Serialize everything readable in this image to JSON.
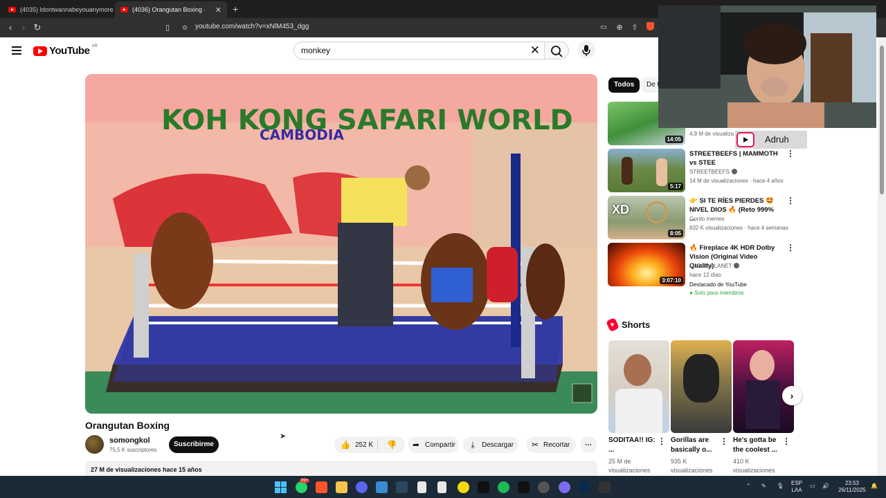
{
  "browser": {
    "tabs": [
      {
        "label": "(4035) Idontwannabeyouanymore Co",
        "active": false
      },
      {
        "label": "(4036) Orangutan Boxing - Yo",
        "active": true
      }
    ],
    "new_tab_icon": "plus-icon",
    "url": "youtube.com/watch?v=xNlM453_dgg"
  },
  "header": {
    "logo_text": "YouTube",
    "country": "AR",
    "search_value": "monkey"
  },
  "video": {
    "overlay_text": "KOH KONG SAFARI WORLD",
    "overlay_sub": "CAMBODIA",
    "title": "Orangutan Boxing",
    "channel": "somongkol",
    "subscribers": "75,5 K suscriptores",
    "subscribe_label": "Suscribirme",
    "likes": "252 K",
    "share_label": "Compartir",
    "download_label": "Descargar",
    "clip_label": "Recortar",
    "views_date": "27 M de visualizaciones  hace 15 años"
  },
  "chips": [
    "Todos",
    "De t"
  ],
  "recommendations": [
    {
      "title": "",
      "channel": "",
      "meta": "4,9 M de visualiza",
      "duration": "14:05"
    },
    {
      "title": "STREETBEEFS | MAMMOTH vs STEE",
      "channel": "STREETBEEFS",
      "meta": "14 M de visualizaciones · hace 4 años",
      "duration": "5:17"
    },
    {
      "title": "👉 SI TE RÍES PIERDES 🤩 NIVEL DIOS 🔥 (Reto 999% ...",
      "channel": "Gordo memes",
      "meta": "832 K visualizaciones · hace 4 semanas",
      "duration": "8:05"
    },
    {
      "title": "🔥 Fireplace 4K HDR Dolby Vision (Original Video Quality)",
      "channel": "FOBOS PLANET",
      "meta": "hace 12 días",
      "duration": "3:07:10",
      "featured": "Destacado de YouTube",
      "members": "Solo para miembros"
    }
  ],
  "shorts": {
    "header": "Shorts",
    "items": [
      {
        "title": "SODITAA!! IG: ...",
        "views": "25 M de visualizaciones"
      },
      {
        "title": "Gorillas are basically o...",
        "views": "935 K visualizaciones"
      },
      {
        "title": "He's gotta be the coolest ...",
        "views": "410 K visualizaciones"
      }
    ]
  },
  "webcam": {
    "streamer": "Adruh"
  },
  "taskbar": {
    "badge": "99+",
    "lang": "ESP",
    "lang2": "LAA",
    "time": "23:53",
    "date": "26/11/2025"
  },
  "colors": {
    "youtube_red": "#ff0000",
    "taskbar": "#1b2a36"
  }
}
